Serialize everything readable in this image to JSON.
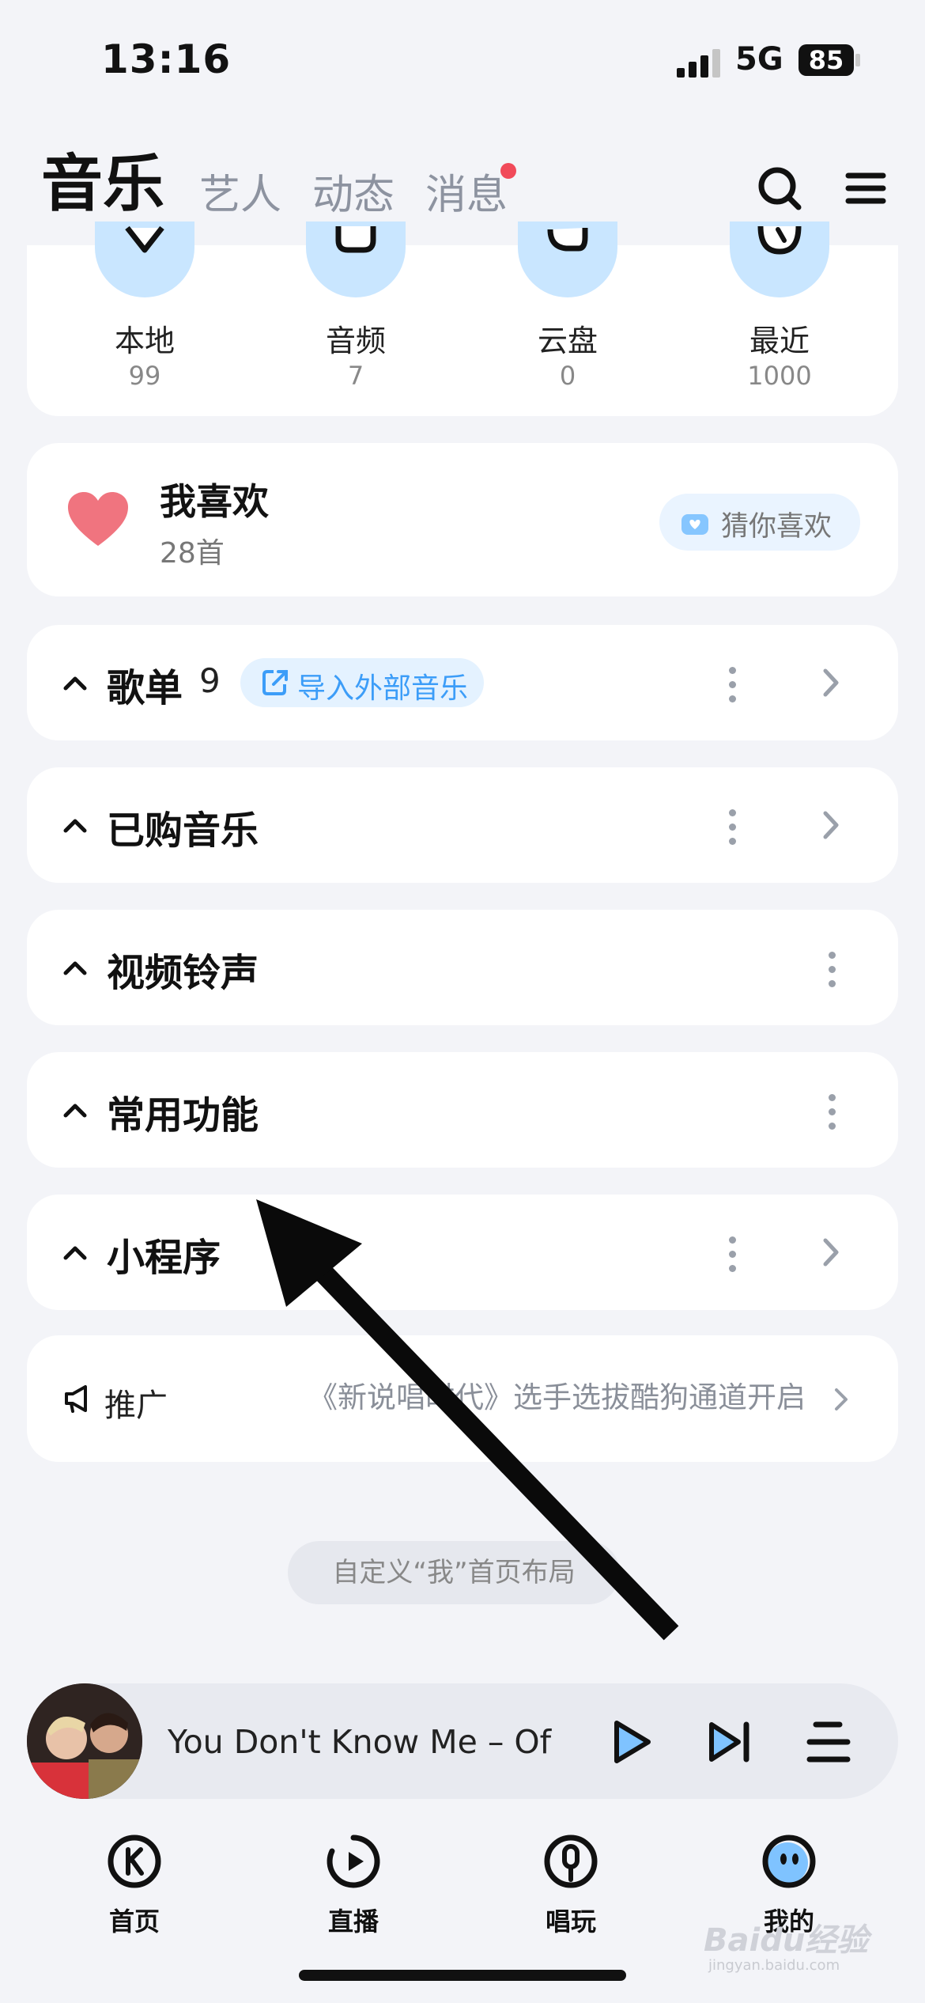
{
  "status_bar": {
    "time": "13:16",
    "network": "5G",
    "battery": "85"
  },
  "header": {
    "tabs": [
      {
        "label": "音乐",
        "active": true
      },
      {
        "label": "艺人"
      },
      {
        "label": "动态"
      },
      {
        "label": "消息"
      }
    ],
    "icons": [
      "search-icon",
      "menu-icon"
    ]
  },
  "quick_access": [
    {
      "label": "本地",
      "count": "99",
      "icon": "heart-shield-icon"
    },
    {
      "label": "音频",
      "count": "7",
      "icon": "audio-icon"
    },
    {
      "label": "云盘",
      "count": "0",
      "icon": "cloud-icon"
    },
    {
      "label": "最近",
      "count": "1000",
      "icon": "clock-icon"
    }
  ],
  "favorites": {
    "title": "我喜欢",
    "count": "28首",
    "guess_label": "猜你喜欢",
    "heart_color": "#f0747f"
  },
  "sections": [
    {
      "title": "歌单",
      "count": "9",
      "import_label": "导入外部音乐",
      "has_more": true,
      "has_arrow": true
    },
    {
      "title": "已购音乐",
      "has_more": true,
      "has_arrow": true
    },
    {
      "title": "视频铃声",
      "has_more": true,
      "has_arrow": false
    },
    {
      "title": "常用功能",
      "has_more": true,
      "has_arrow": false
    },
    {
      "title": "小程序",
      "has_more": true,
      "has_arrow": true
    }
  ],
  "promo": {
    "label": "推广",
    "text": "《新说唱时代》选手选拔酷狗通道开启"
  },
  "customize_label": "自定义“我”首页布局",
  "player": {
    "song": "You Don't Know Me – Of",
    "controls": [
      "play-icon",
      "next-icon",
      "playlist-icon"
    ]
  },
  "bottom_nav": [
    {
      "label": "首页",
      "icon": "k-home-icon"
    },
    {
      "label": "直播",
      "icon": "live-play-icon"
    },
    {
      "label": "唱玩",
      "icon": "sing-mic-icon"
    },
    {
      "label": "我的",
      "icon": "my-face-icon",
      "active": true
    }
  ],
  "watermark": {
    "text": "Baidu经验",
    "sub": "jingyan.baidu.com"
  },
  "colors": {
    "accent": "#43a7ff",
    "badge": "#f14a5a",
    "import_text": "#3c9df8"
  }
}
